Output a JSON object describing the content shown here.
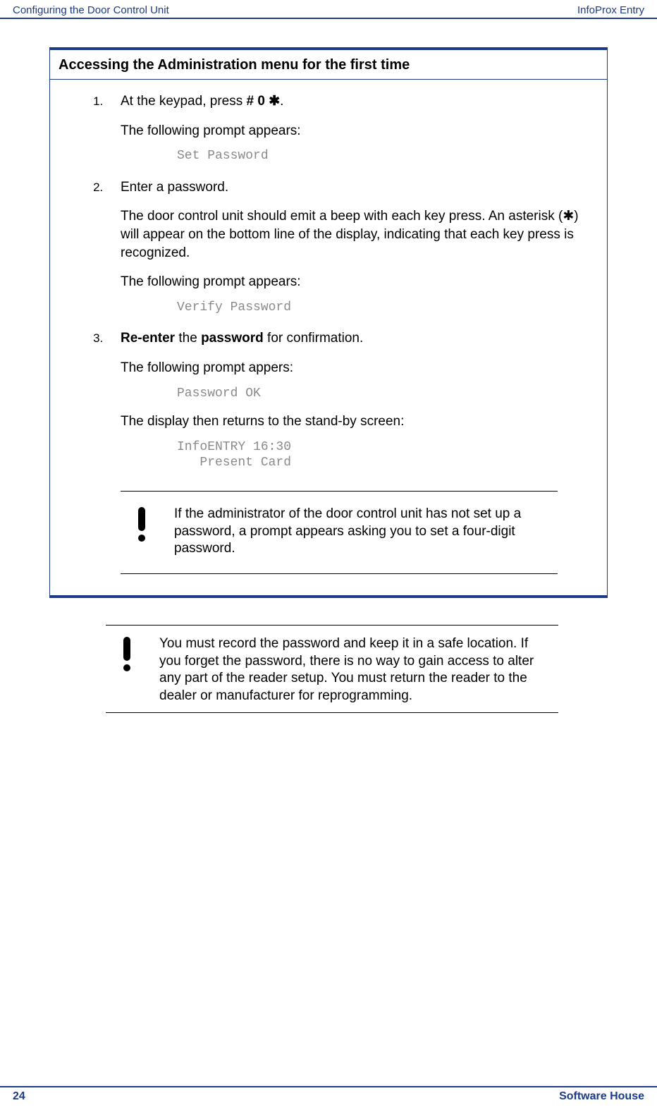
{
  "header": {
    "left": "Configuring the Door Control Unit",
    "right": "InfoProx Entry"
  },
  "box": {
    "title": "Accessing the Administration menu for the first time",
    "steps": [
      {
        "lead": "At the keypad, press ",
        "cmd": "# 0 ✱",
        "tail": ".",
        "paras": [
          {
            "text": "The following prompt appears:"
          }
        ],
        "mono": "Set Password"
      },
      {
        "lead": "Enter a password.",
        "paras": [
          {
            "text": "The door control unit should emit a beep with each key press. An asterisk (✱) will appear on the bottom line of the display, indicating that each key press is recognized."
          },
          {
            "text": "The following prompt appears:"
          }
        ],
        "mono": "Verify Password"
      },
      {
        "lead_pre": "Re-enter",
        "lead_mid": " the ",
        "lead_bold2": "password",
        "lead_post": " for confirmation.",
        "paras": [
          {
            "text": "The following prompt appers:"
          }
        ],
        "mono": "Password OK",
        "paras2": [
          {
            "text": "The display then returns to the stand-by screen:"
          }
        ],
        "mono2": "InfoENTRY 16:30\n   Present Card"
      }
    ],
    "note_inside": "If the administrator of the door control unit has not set up a password, a prompt appears asking you to set a four-digit password."
  },
  "note_outside": "You must record the password and keep it in a safe location. If you forget the password, there is no way to gain access to alter any part of the reader setup. You must return the reader to the dealer or manufacturer for reprogramming.",
  "footer": {
    "left": "24",
    "right": "Software House"
  }
}
